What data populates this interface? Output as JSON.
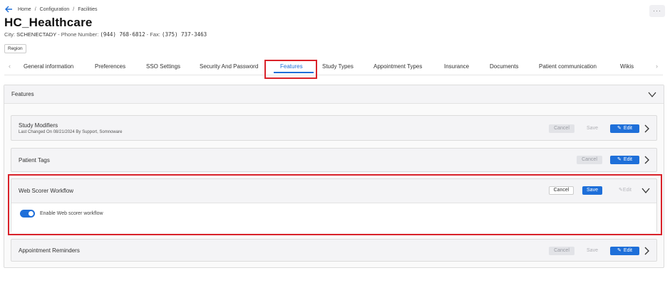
{
  "breadcrumb": {
    "items": [
      "Home",
      "Configuration",
      "Facilities"
    ]
  },
  "more_menu": {
    "label": "···"
  },
  "page": {
    "title": "HC_Healthcare",
    "city_label": "City:",
    "city": "SCHENECTADY",
    "phone_label": " - Phone Number:",
    "phone": "(944) 768-6812",
    "fax_label": " - Fax:",
    "fax": "(375) 737-3463",
    "region_badge": "Region"
  },
  "tabs": [
    {
      "label": "General information"
    },
    {
      "label": "Preferences"
    },
    {
      "label": "SSO Settings"
    },
    {
      "label": "Security And Password"
    },
    {
      "label": "Features",
      "active": true
    },
    {
      "label": "Study Types"
    },
    {
      "label": "Appointment Types"
    },
    {
      "label": "Insurance"
    },
    {
      "label": "Documents"
    },
    {
      "label": "Patient communication"
    },
    {
      "label": "Wikis"
    }
  ],
  "features": {
    "title": "Features",
    "cards": [
      {
        "title": "Study Modifiers",
        "subtitle": "Last Changed On 08/21/2024 By Support, Somnoware",
        "cancel": "Cancel",
        "save": "Save",
        "edit": "Edit"
      },
      {
        "title": "Patient Tags",
        "cancel": "Cancel",
        "edit": "Edit"
      },
      {
        "title": "Web Scorer Workflow",
        "cancel": "Cancel",
        "save": "Save",
        "edit": "Edit",
        "toggle_label": "Enable Web scorer workflow",
        "toggle_on": true
      },
      {
        "title": "Appointment Reminders",
        "cancel": "Cancel",
        "save": "Save",
        "edit": "Edit"
      }
    ]
  },
  "colors": {
    "accent": "#1e6fd9",
    "highlight_red": "#d9222a"
  },
  "icons": {
    "back": "arrow-left-icon",
    "expand": "chevron-down-icon",
    "collapsed": "chevron-right-icon",
    "edit": "pencil-icon"
  }
}
